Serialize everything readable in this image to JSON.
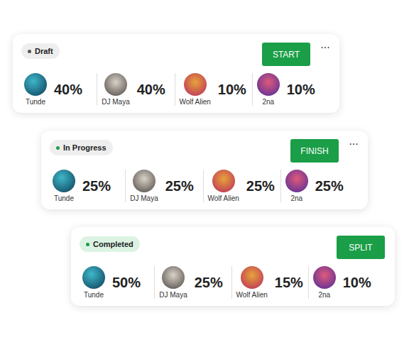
{
  "cards": [
    {
      "status": {
        "label": "Draft",
        "color": "#555555",
        "background": "#eeeeee"
      },
      "action": "START",
      "more": "···",
      "members": [
        {
          "name": "Tunde",
          "share": "40%"
        },
        {
          "name": "DJ Maya",
          "share": "40%"
        },
        {
          "name": "Wolf Alien",
          "share": "10%"
        },
        {
          "name": "2na",
          "share": "10%"
        }
      ]
    },
    {
      "status": {
        "label": "In Progress",
        "color": "#1f9d4a",
        "background": "#eeeeee"
      },
      "action": "FINISH",
      "more": "···",
      "members": [
        {
          "name": "Tunde",
          "share": "25%"
        },
        {
          "name": "DJ Maya",
          "share": "25%"
        },
        {
          "name": "Wolf Alien",
          "share": "25%"
        },
        {
          "name": "2na",
          "share": "25%"
        }
      ]
    },
    {
      "status": {
        "label": "Completed",
        "color": "#1f9d4a",
        "background": "#dcf3e3"
      },
      "action": "SPLIT",
      "members": [
        {
          "name": "Tunde",
          "share": "50%"
        },
        {
          "name": "DJ Maya",
          "share": "25%"
        },
        {
          "name": "Wolf Alien",
          "share": "15%"
        },
        {
          "name": "2na",
          "share": "10%"
        }
      ]
    }
  ]
}
